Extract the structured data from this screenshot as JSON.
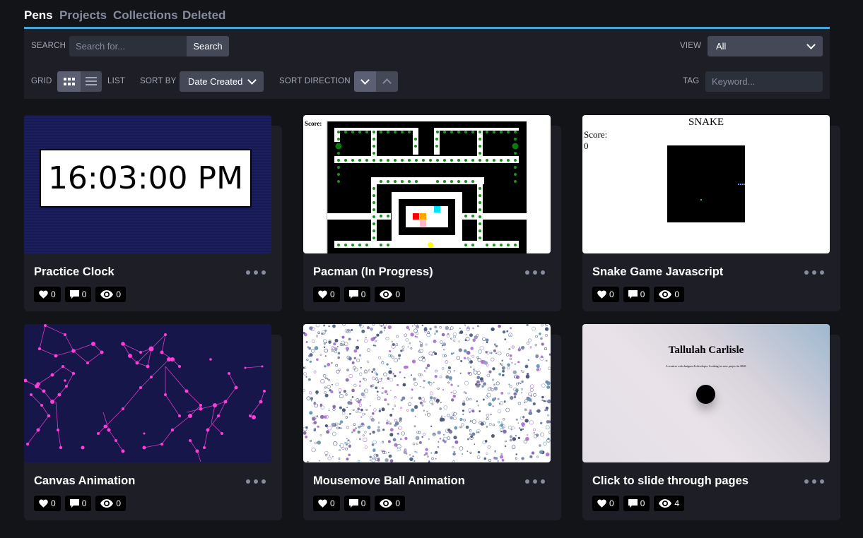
{
  "tabs": [
    {
      "label": "Pens"
    },
    {
      "label": "Projects"
    },
    {
      "label": "Collections"
    },
    {
      "label": "Deleted"
    }
  ],
  "toolbar": {
    "search_label": "Search",
    "search_placeholder": "Search for...",
    "search_button": "Search",
    "view_label": "View",
    "view_value": "All",
    "grid_label": "Grid",
    "list_label": "List",
    "sort_by_label": "Sort By",
    "sort_by_value": "Date Created",
    "sort_direction_label": "Sort Direction",
    "tag_label": "Tag",
    "tag_placeholder": "Keyword..."
  },
  "pens": [
    {
      "title": "Practice Clock",
      "likes": "0",
      "comments": "0",
      "views": "0",
      "clock_text": "16:03:00 PM"
    },
    {
      "title": "Pacman (In Progress)",
      "likes": "0",
      "comments": "0",
      "views": "0",
      "score_label": "Score:"
    },
    {
      "title": "Snake Game Javascript",
      "likes": "0",
      "comments": "0",
      "views": "0",
      "heading": "SNAKE",
      "score_label": "Score:",
      "score_value": "0"
    },
    {
      "title": "Canvas Animation",
      "likes": "0",
      "comments": "0",
      "views": "0"
    },
    {
      "title": "Mousemove Ball Animation",
      "likes": "0",
      "comments": "0",
      "views": "0"
    },
    {
      "title": "Click to slide through pages",
      "likes": "0",
      "comments": "0",
      "views": "4",
      "heading": "Tallulah Carlisle",
      "subtext": "A creative web designer & developer. Looking for new project in 2020."
    }
  ],
  "colors": {
    "accent": "#47a6d9",
    "background": "#131417",
    "panel": "#1e1f26",
    "button": "#444857",
    "network": "#ff3dd8"
  },
  "icons": [
    "heart-icon",
    "comment-icon",
    "eye-icon",
    "more-icon",
    "grid-icon",
    "list-icon",
    "chevron-down-icon",
    "chevron-up-icon"
  ]
}
